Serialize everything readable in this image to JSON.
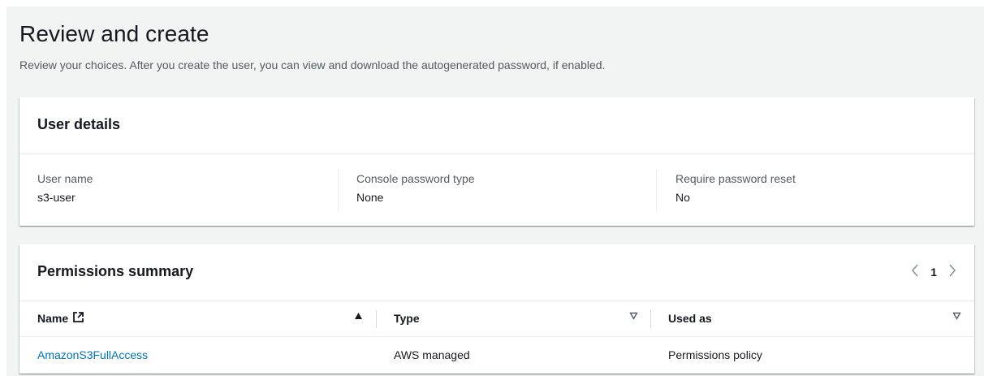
{
  "page": {
    "title": "Review and create",
    "subtitle": "Review your choices. After you create the user, you can view and download the autogenerated password, if enabled."
  },
  "user_details": {
    "title": "User details",
    "fields": [
      {
        "label": "User name",
        "value": "s3-user"
      },
      {
        "label": "Console password type",
        "value": "None"
      },
      {
        "label": "Require password reset",
        "value": "No"
      }
    ]
  },
  "permissions": {
    "title": "Permissions summary",
    "pagination": {
      "current_page": "1",
      "prev_icon": "chevron-left-icon",
      "next_icon": "chevron-right-icon"
    },
    "columns": {
      "name": "Name",
      "type": "Type",
      "used_as": "Used as"
    },
    "rows": [
      {
        "name": "AmazonS3FullAccess",
        "type": "AWS managed",
        "used_as": "Permissions policy"
      }
    ]
  },
  "colors": {
    "background": "#f2f3f3",
    "link": "#0073bb",
    "text": "#16191f",
    "secondary_text": "#545b64"
  }
}
